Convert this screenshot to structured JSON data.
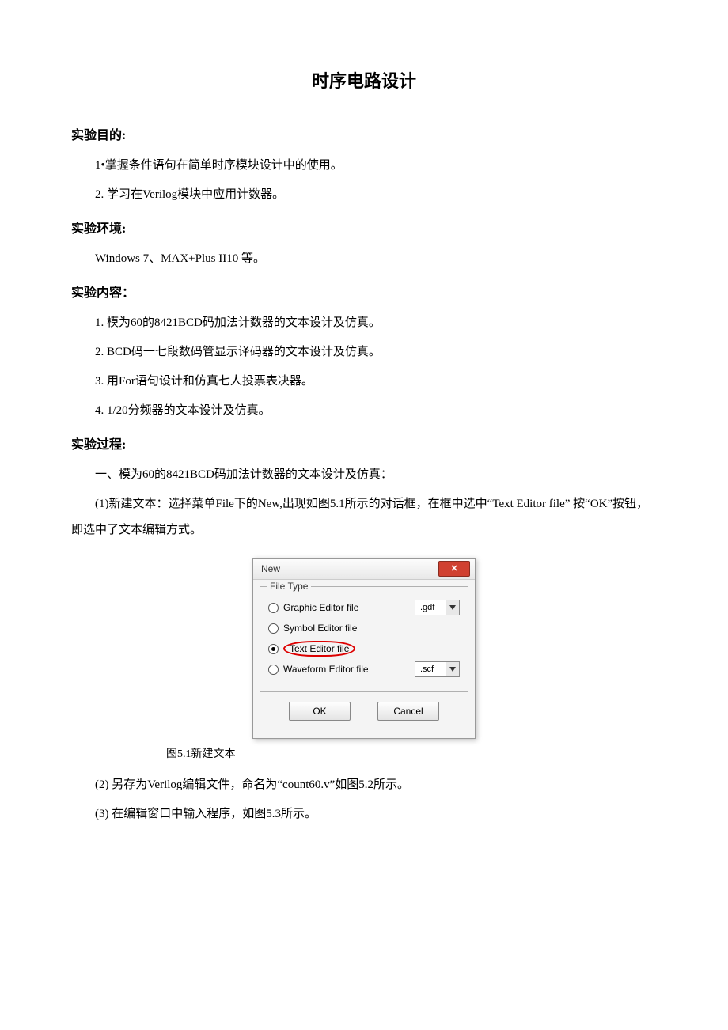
{
  "title": "时序电路设计",
  "sections": {
    "purpose_heading": "实验目的:",
    "purpose_items": [
      "1•掌握条件语句在简单时序模块设计中的使用。",
      "2.   学习在Verilog模块中应用计数器。"
    ],
    "env_heading": "实验环境:",
    "env_text": "Windows 7、MAX+Plus II10 等。",
    "content_heading": "实验内容：",
    "content_items": [
      "1. 模为60的8421BCD码加法计数器的文本设计及仿真。",
      "2. BCD码一七段数码管显示译码器的文本设计及仿真。",
      "3. 用For语句设计和仿真七人投票表决器。",
      "4. 1/20分频器的文本设计及仿真。"
    ],
    "process_heading": "实验过程:",
    "process_intro": "一、模为60的8421BCD码加法计数器的文本设计及仿真：",
    "step1": "(1)新建文本：选择菜单File下的New,出现如图5.1所示的对话框，在框中选中“Text Editor file”  按“OK”按钮，即选中了文本编辑方式。",
    "figure_caption": "图5.1新建文本",
    "step2": "(2)  另存为Verilog编辑文件，命名为“count60.v”如图5.2所示。",
    "step3": "(3)  在编辑窗口中输入程序，如图5.3所示。"
  },
  "dialog": {
    "title": "New",
    "close": "✕",
    "group_label": "File Type",
    "options": [
      {
        "label": "Graphic Editor file",
        "ext": ".gdf",
        "selected": false,
        "has_ext": true
      },
      {
        "label": "Symbol Editor file",
        "ext": "",
        "selected": false,
        "has_ext": false
      },
      {
        "label": "Text Editor file",
        "ext": "",
        "selected": true,
        "has_ext": false
      },
      {
        "label": "Waveform Editor file",
        "ext": ".scf",
        "selected": false,
        "has_ext": true
      }
    ],
    "ok": "OK",
    "cancel": "Cancel"
  }
}
